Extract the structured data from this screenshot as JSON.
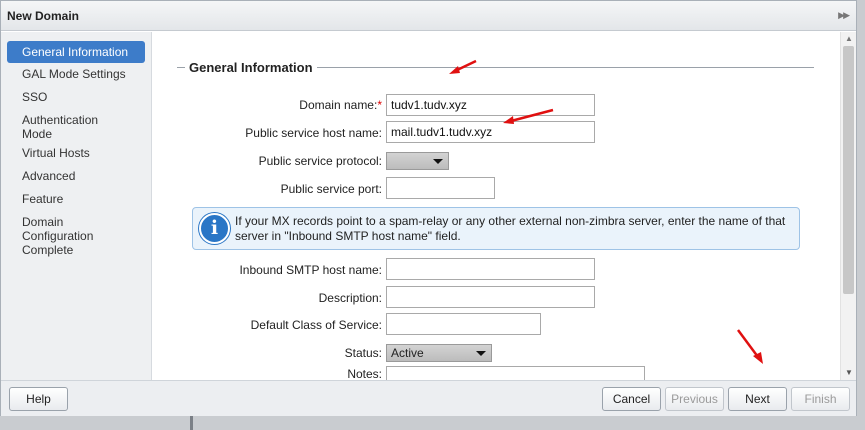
{
  "dialog": {
    "title": "New Domain"
  },
  "nav": {
    "items": [
      {
        "label": "General Information",
        "active": true
      },
      {
        "label": "GAL Mode Settings"
      },
      {
        "label": "SSO"
      },
      {
        "label": "Authentication\nMode"
      },
      {
        "label": "Virtual Hosts"
      },
      {
        "label": "Advanced"
      },
      {
        "label": "Feature"
      },
      {
        "label": "Domain\nConfiguration\nComplete"
      }
    ]
  },
  "form": {
    "section_title": "General Information",
    "domain_name": {
      "label": "Domain name:",
      "required_mark": "*",
      "value": "tudv1.tudv.xyz"
    },
    "public_host": {
      "label": "Public service host name:",
      "value": "mail.tudv1.tudv.xyz"
    },
    "public_protocol": {
      "label": "Public service protocol:",
      "value": ""
    },
    "public_port": {
      "label": "Public service port:",
      "value": ""
    },
    "info_message": "If your MX records point to a spam-relay or any other external non-zimbra server, enter the name of that server in \"Inbound SMTP host name\" field.",
    "inbound_smtp": {
      "label": "Inbound SMTP host name:",
      "value": ""
    },
    "description": {
      "label": "Description:",
      "value": ""
    },
    "cos": {
      "label": "Default Class of Service:",
      "value": ""
    },
    "status": {
      "label": "Status:",
      "value": "Active"
    },
    "notes": {
      "label": "Notes:",
      "value": ""
    }
  },
  "footer": {
    "help": "Help",
    "cancel": "Cancel",
    "previous": "Previous",
    "next": "Next",
    "finish": "Finish"
  },
  "colors": {
    "accent": "#3d7cc9",
    "annotation": "#e01010",
    "info_icon": "#2a76c6"
  }
}
